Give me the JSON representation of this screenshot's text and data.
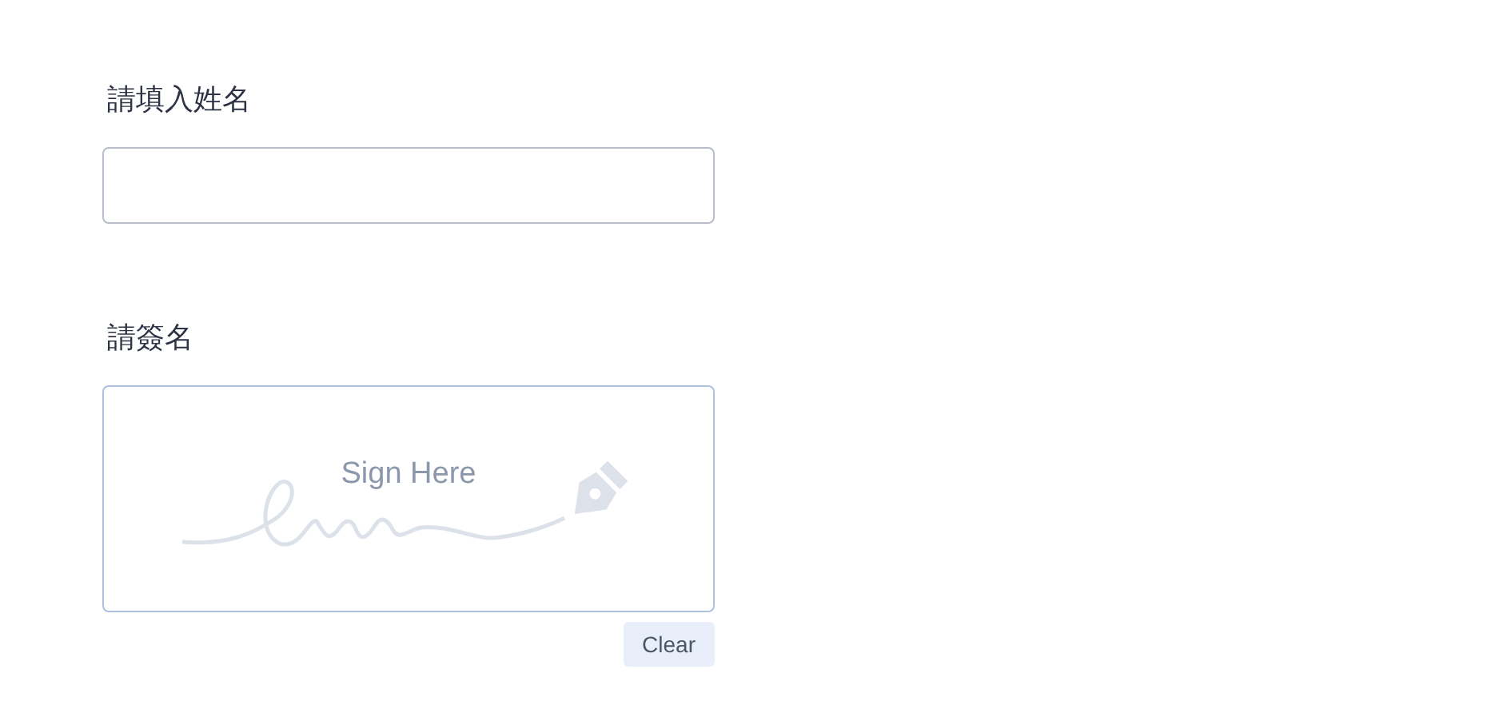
{
  "name_field": {
    "label": "請填入姓名"
  },
  "signature": {
    "label": "請簽名",
    "pad_hint": "Sign Here",
    "clear_button": "Clear"
  }
}
